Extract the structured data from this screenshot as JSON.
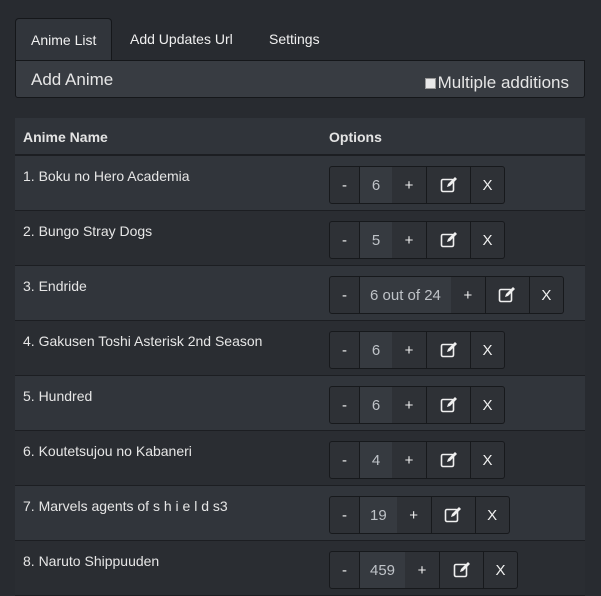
{
  "tabs": [
    {
      "label": "Anime List",
      "active": true
    },
    {
      "label": "Add Updates Url",
      "active": false
    },
    {
      "label": "Settings",
      "active": false
    }
  ],
  "add_bar": {
    "title": "Add Anime",
    "multiple_label": "Multiple additions",
    "multiple_checked": false
  },
  "table": {
    "headers": {
      "name": "Anime Name",
      "options": "Options"
    },
    "rows": [
      {
        "name": "1. Boku no Hero Academia",
        "count": "6"
      },
      {
        "name": "2. Bungo Stray Dogs",
        "count": "5"
      },
      {
        "name": "3. Endride",
        "count": "6 out of 24"
      },
      {
        "name": "4. Gakusen Toshi Asterisk 2nd Season",
        "count": "6"
      },
      {
        "name": "5. Hundred",
        "count": "6"
      },
      {
        "name": "6. Koutetsujou no Kabaneri",
        "count": "4"
      },
      {
        "name": "7. Marvels agents of s h i e l d s3",
        "count": "19"
      },
      {
        "name": "8. Naruto Shippuuden",
        "count": "459"
      }
    ],
    "buttons": {
      "minus": "-",
      "plus": "+",
      "delete": "X",
      "edit_icon": "edit-icon"
    }
  },
  "colors": {
    "background": "#282b30",
    "panel": "#383c42",
    "row_odd": "#31353b",
    "row_even": "#2a2d32"
  }
}
